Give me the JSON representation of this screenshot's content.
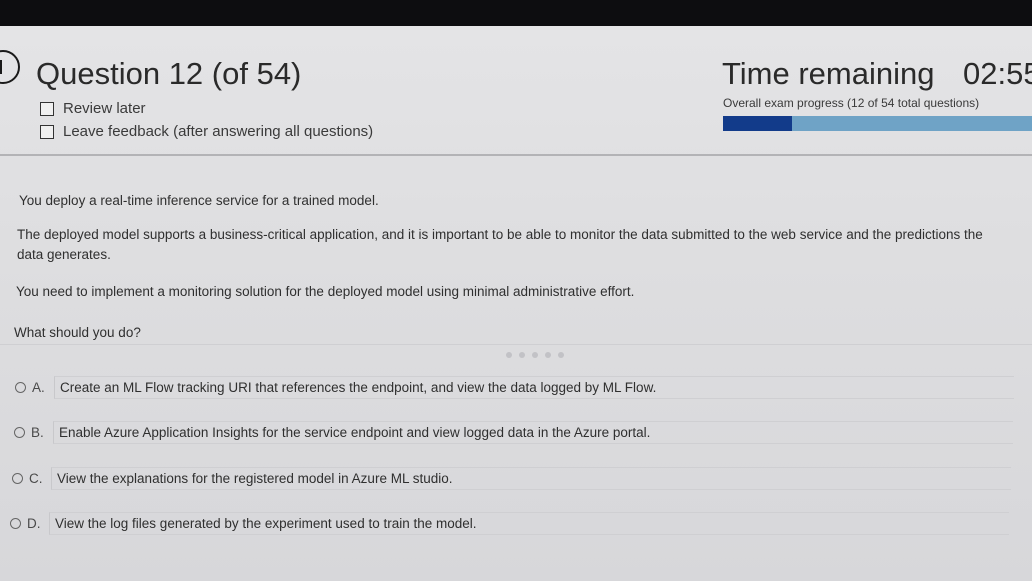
{
  "header": {
    "question_title": "Question 12 (of 54)",
    "review_later_label": "Review later",
    "leave_feedback_label": "Leave feedback (after answering all questions)",
    "time_remaining_label": "Time remaining",
    "time_remaining_value": "02:55",
    "progress_text": "Overall exam progress (12 of 54 total questions)",
    "progress_fraction": 0.222
  },
  "question": {
    "p1": "You deploy a real-time inference service for a trained model.",
    "p2_line1": "The deployed model supports a business-critical application, and it is important to be able to monitor the data submitted to the web service and the predictions the",
    "p2_line2": "data generates.",
    "p3": "You need to implement a monitoring solution for the deployed model using minimal administrative effort.",
    "prompt": "What should you do?"
  },
  "options": [
    {
      "letter": "A.",
      "text": "Create an ML Flow tracking URI that references the endpoint, and view the data logged by ML Flow."
    },
    {
      "letter": "B.",
      "text": "Enable Azure Application Insights for the service endpoint and view logged data in the Azure portal."
    },
    {
      "letter": "C.",
      "text": "View the explanations for the registered model in Azure ML studio."
    },
    {
      "letter": "D.",
      "text": "View the log files generated by the experiment used to train the model."
    }
  ],
  "colors": {
    "progress_fill": "#123b8a",
    "progress_track": "#6fa3c6",
    "background": "#e4e4e6"
  }
}
